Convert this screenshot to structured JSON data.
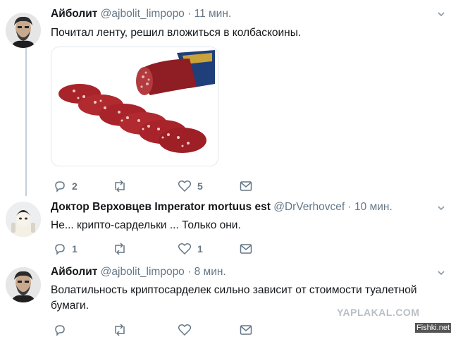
{
  "tweets": [
    {
      "name": "Айболит",
      "handle": "@ajbolit_limpopo",
      "dot": "·",
      "time": "11 мин.",
      "text": "Почитал ленту, решил вложиться в колбаскоины.",
      "replies": "2",
      "retweets": "",
      "likes": "5"
    },
    {
      "name": "Доктор Верховцев Imperator mortuus est",
      "handle": "@DrVerhovcef",
      "dot": "·",
      "time": "10 мин.",
      "text": "Не... крипто-сардельки ... Только они.",
      "replies": "1",
      "retweets": "",
      "likes": "1"
    },
    {
      "name": "Айболит",
      "handle": "@ajbolit_limpopo",
      "dot": "·",
      "time": "8 мин.",
      "text_line1": "Волатильность криптосарделек сильно зависит от стоимости туалетной",
      "text_line2": "бумаги.",
      "replies": "",
      "retweets": "",
      "likes": ""
    }
  ],
  "watermarks": {
    "site1": "YAPLAKAL.COM",
    "site2": "Fishki.net"
  },
  "icons": {
    "reply": "reply-icon",
    "retweet": "retweet-icon",
    "like": "heart-icon",
    "dm": "envelope-icon",
    "more": "chevron-down-icon"
  },
  "colors": {
    "icon_gray": "#657786",
    "thread_line": "#c4cfd6",
    "salami_red": "#a8232a"
  }
}
